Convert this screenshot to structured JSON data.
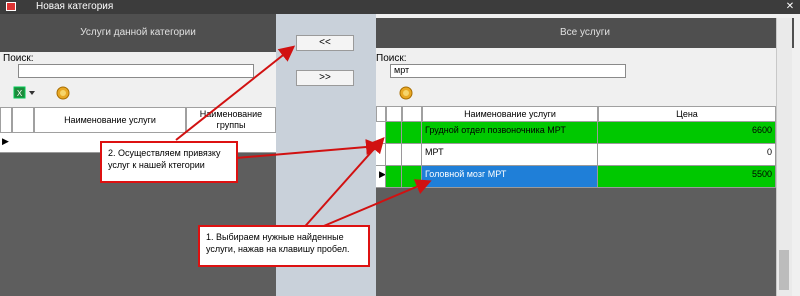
{
  "window": {
    "title": "Новая категория"
  },
  "left_panel": {
    "header": "Услуги данной категории",
    "search_label": "Поиск:",
    "search_value": "",
    "columns": [
      "Наименование услуги",
      "Наименование группы"
    ],
    "row_marker": "▶"
  },
  "middle": {
    "add_label": "<<",
    "remove_label": ">>"
  },
  "right_panel": {
    "header": "Все услуги",
    "search_label": "Поиск:",
    "search_value": "мрт",
    "columns": [
      "Наименование услуги",
      "Цена"
    ],
    "rows": [
      {
        "name": "Грудной отдел позвоночника МРТ",
        "price": "6600",
        "state": "checked"
      },
      {
        "name": "МРТ",
        "price": "0",
        "state": "normal"
      },
      {
        "name": "Головной мозг МРТ",
        "price": "5500",
        "state": "selected"
      }
    ],
    "row_marker": "▶"
  },
  "callouts": {
    "step2": "2. Осуществляем привязку услуг к нашей ктегории",
    "step1": "1. Выбираем нужные найденные услуги, нажав на клавишу пробел."
  },
  "colors": {
    "accent": "#d11111",
    "checked": "#00c800",
    "selected": "#1f7fd8"
  },
  "icons": {
    "export": "excel-export-icon",
    "refresh": "refresh-icon",
    "close": "close-icon"
  }
}
